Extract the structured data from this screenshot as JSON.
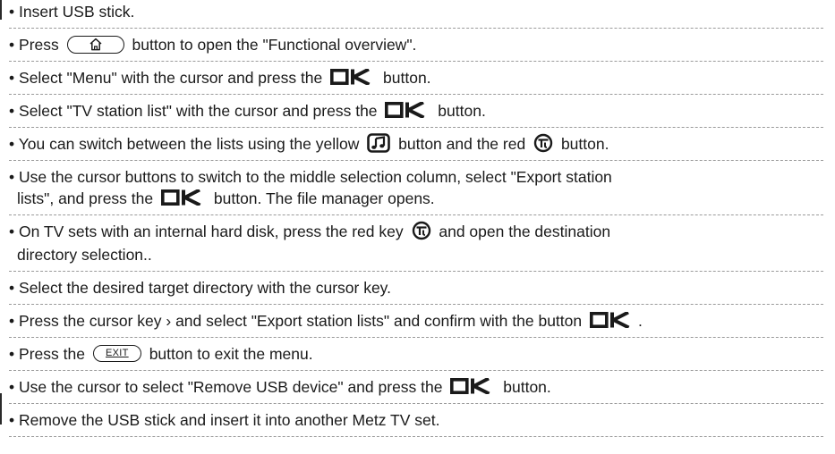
{
  "icons": {
    "home": "home-icon",
    "ok": "ok-icon",
    "music": "music-note-icon",
    "teletext": "teletext-icon",
    "exit": "exit-key-icon"
  },
  "bullet": "•",
  "steps": {
    "s1": "Insert USB stick.",
    "s2a": "Press",
    "s2b": "button to open the \"Functional overview\".",
    "s3a": "Select \"Menu\" with the cursor and press the",
    "s3b": "button.",
    "s4a": "Select \"TV station list\" with the cursor and press the",
    "s4b": "button.",
    "s5a": "You can switch between the lists using the yellow",
    "s5b": "button and the red",
    "s5c": "button.",
    "s6a": "Use the cursor buttons to switch to the middle selection column, select \"Export station",
    "s6b": "lists\", and press the",
    "s6c": "button. The file manager opens.",
    "s7a": "On TV sets with an internal hard disk, press the red key",
    "s7b": "and open the destination",
    "s7c": "directory selection..",
    "s8": "Select the desired target directory with the cursor key.",
    "s9a": "Press the cursor key › and select \"Export station lists\" and confirm with the button",
    "s9b": ".",
    "s10a": "Press the",
    "s10b": "button to exit the menu.",
    "exit_label": "EXIT",
    "s11a": "Use the cursor to select \"Remove USB device\" and press the",
    "s11b": "button.",
    "s12": "Remove the USB stick and insert it into another Metz TV set."
  }
}
